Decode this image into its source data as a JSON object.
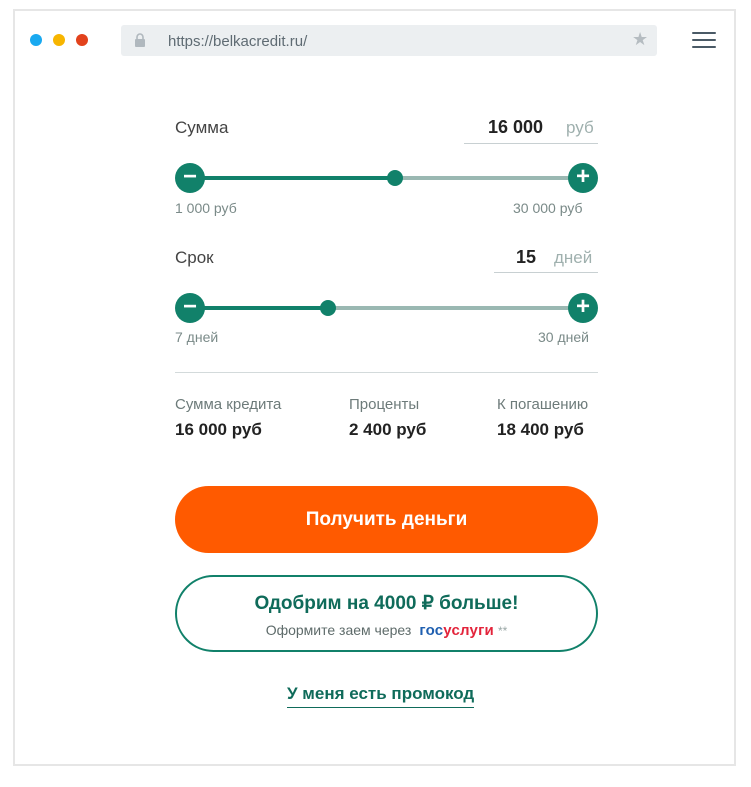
{
  "browser": {
    "url": "https://belkacredit.ru/",
    "icons": {
      "lock": "lock-icon",
      "star": "star-icon",
      "menu": "hamburger-menu-icon"
    },
    "dots": [
      "#19a9f0",
      "#f7b500",
      "#e2421c"
    ]
  },
  "amount": {
    "label": "Сумма",
    "value": "16 000",
    "unit": "руб",
    "min_label": "1 000 руб",
    "max_label": "30 000 руб",
    "slider_level": 0.52,
    "minus": "−",
    "plus": "+"
  },
  "term": {
    "label": "Срок",
    "value": "15",
    "unit": "дней",
    "min_label": "7 дней",
    "max_label": "30 дней",
    "slider_level": 0.35,
    "minus": "−",
    "plus": "+"
  },
  "summary": {
    "credit_label": "Сумма кредита",
    "credit_value": "16 000 руб",
    "interest_label": "Проценты",
    "interest_value": "2 400 руб",
    "repay_label": "К погашению",
    "repay_value": "18 400 руб"
  },
  "cta": {
    "label": "Получить деньги",
    "color": "#ff5a00"
  },
  "gosuslugi": {
    "title": "Одобрим на 4000 ₽ больше!",
    "subtitle": "Оформите заем через",
    "logo_part1": "гос",
    "logo_part2": "услуги",
    "asterisks": "**"
  },
  "promo": {
    "label": "У меня есть промокод"
  },
  "colors": {
    "accent": "#11816a",
    "cta": "#ff5a00",
    "track": "#9ab8b2"
  }
}
